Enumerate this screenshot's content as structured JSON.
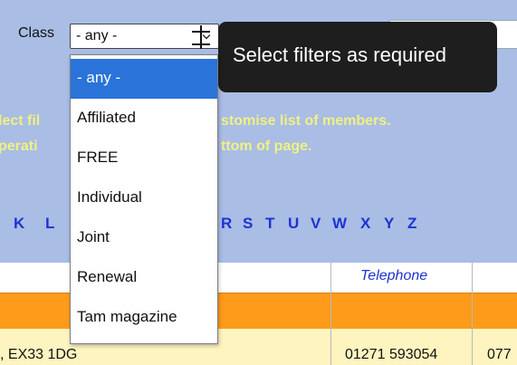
{
  "filter": {
    "label": "Class",
    "selected_value": "- any -",
    "options": [
      "- any -",
      "Affiliated",
      "FREE",
      "Individual",
      "Joint",
      "Renewal",
      "Tam magazine"
    ]
  },
  "tooltip": {
    "text": "Select filters as required"
  },
  "instructions": {
    "line1_left": "lect fil",
    "line1_right": "stomise list of members.",
    "line2_left": "perati",
    "line2_right": "ttom of page."
  },
  "alphabet": [
    "K",
    "L",
    "R",
    "S",
    "T",
    "U",
    "V",
    "W",
    "X",
    "Y",
    "Z"
  ],
  "table": {
    "header_telephone": "Telephone",
    "row_address": ", EX33 1DG",
    "row_telephone": "01271 593054",
    "row_extra": "077"
  },
  "colors": {
    "panel_bg": "#a9bde5",
    "selected_option": "#2a73d9",
    "orange_row": "#ff9b1a",
    "yellow_row": "#fdf4c0",
    "letters": "#1d33d2",
    "instructions": "#f1f081"
  }
}
